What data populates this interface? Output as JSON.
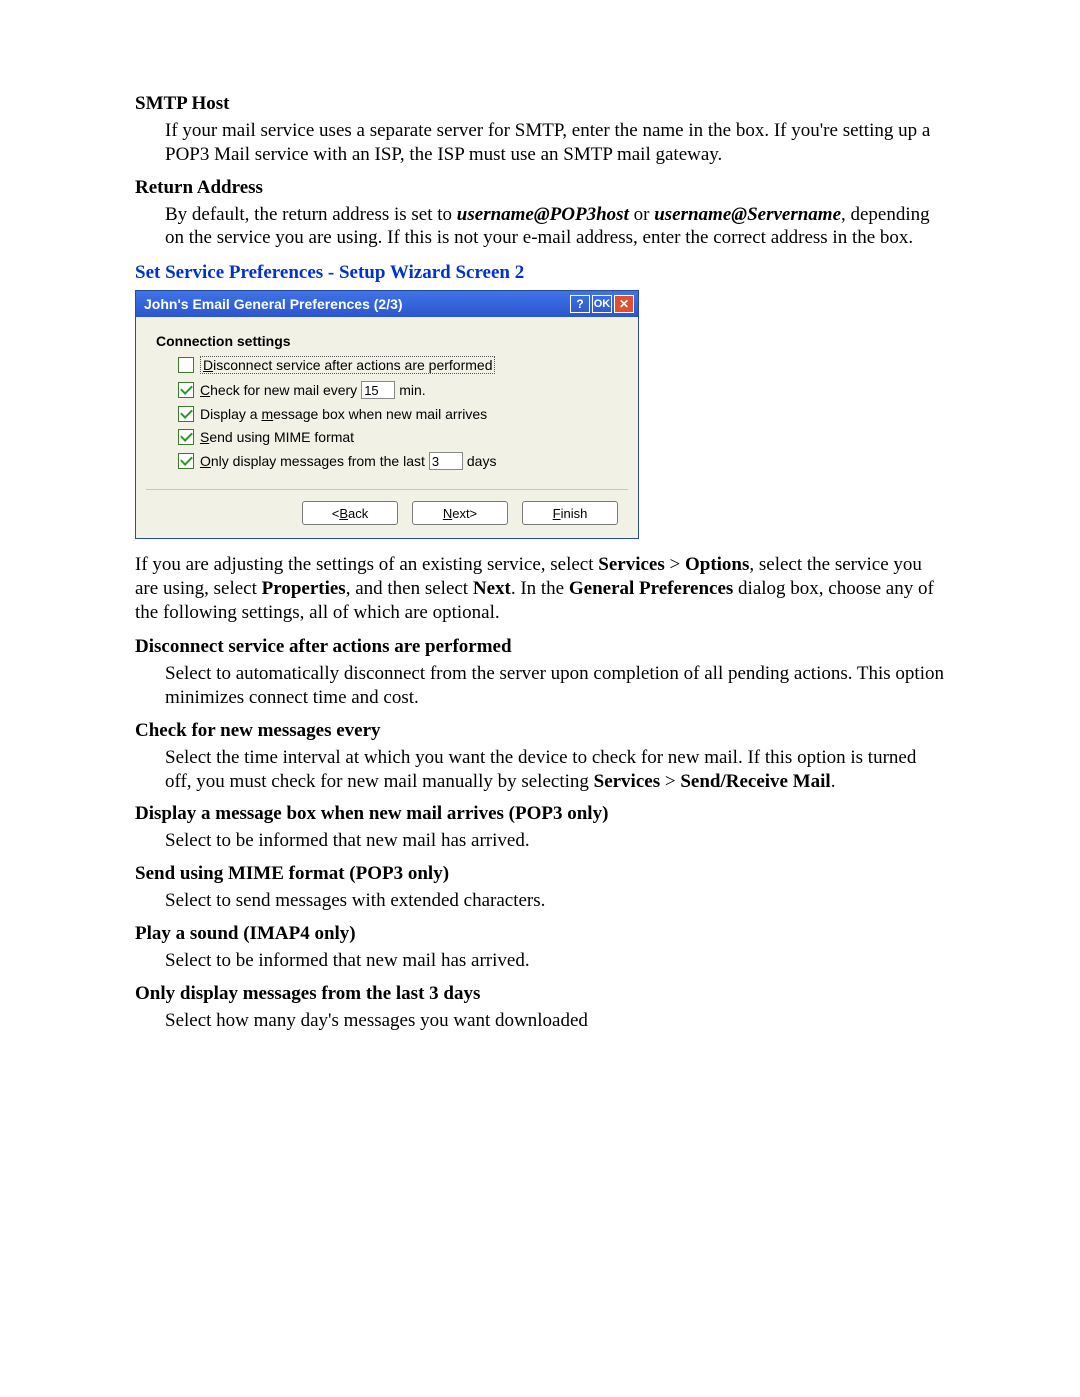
{
  "sections": {
    "smtp": {
      "title": "SMTP Host",
      "body": "If your mail service uses a separate server for SMTP, enter the name in the box. If you're setting up a POP3 Mail service with an ISP, the ISP must use an SMTP mail gateway."
    },
    "return_addr": {
      "title": "Return Address",
      "body_pre": "By default, the return address is set to ",
      "val1": "username@POP3host",
      "or": " or ",
      "val2": "username@Servername",
      "body_post": ", depending on the service you are using. If this is not your e-mail address, enter the correct address in the box."
    }
  },
  "blue_heading": "Set Service Preferences  -  Setup Wizard Screen 2",
  "dialog": {
    "title": "John's Email General Preferences (2/3)",
    "help_btn": "?",
    "ok_btn": "OK",
    "close_btn": "✕",
    "group_label": "Connection settings",
    "opts": {
      "disconnect": {
        "checked": false,
        "pre": "",
        "u": "D",
        "post": "isconnect service after actions are performed"
      },
      "check_mail": {
        "checked": true,
        "pre": "",
        "u": "C",
        "post": "heck for new mail every",
        "value": "15",
        "unit": "min."
      },
      "msg_box": {
        "checked": true,
        "pre": "Display a ",
        "u": "m",
        "post": "essage box when new mail arrives"
      },
      "mime": {
        "checked": true,
        "pre": "",
        "u": "S",
        "post": "end using MIME format"
      },
      "last_days": {
        "checked": true,
        "pre": "",
        "u": "O",
        "post": "nly display messages from the last",
        "value": "3",
        "unit": "days"
      }
    },
    "buttons": {
      "back": "<Back",
      "next": "Next>",
      "finish": "Finish"
    }
  },
  "after_dialog": {
    "p1_pre": "If you are adjusting the settings of an existing service, select ",
    "services": "Services",
    "gt": " > ",
    "options": "Options",
    "p1_mid": ", select the service you are using, select ",
    "properties": "Properties",
    "p1_mid2": ", and then select ",
    "next": "Next",
    "p1_mid3": ". In the ",
    "genprefs": "General Preferences",
    "p1_post": " dialog box, choose any of the following settings, all of which are optional."
  },
  "defs": {
    "d1": {
      "t": "Disconnect service after actions are performed",
      "b": "Select to automatically disconnect from the server upon completion of all pending actions. This option minimizes connect time and cost."
    },
    "d2": {
      "t": "Check for new messages every",
      "b_pre": "Select the time interval at which you want the device to check for new mail. If this option is turned off, you must check for new mail manually by selecting ",
      "services": "Services",
      "gt": " > ",
      "sendrecv": "Send/Receive Mail",
      "b_post": "."
    },
    "d3": {
      "t": "Display a message box when new mail arrives (POP3 only)",
      "b": "Select to be informed that new mail has arrived."
    },
    "d4": {
      "t": "Send using MIME format (POP3 only)",
      "b": "Select to send messages with extended characters."
    },
    "d5": {
      "t": "Play a sound (IMAP4 only)",
      "b": "Select to be informed that new mail has arrived."
    },
    "d6": {
      "t": "Only display messages from the last 3 days",
      "b": "Select how many day's messages you want downloaded"
    }
  }
}
